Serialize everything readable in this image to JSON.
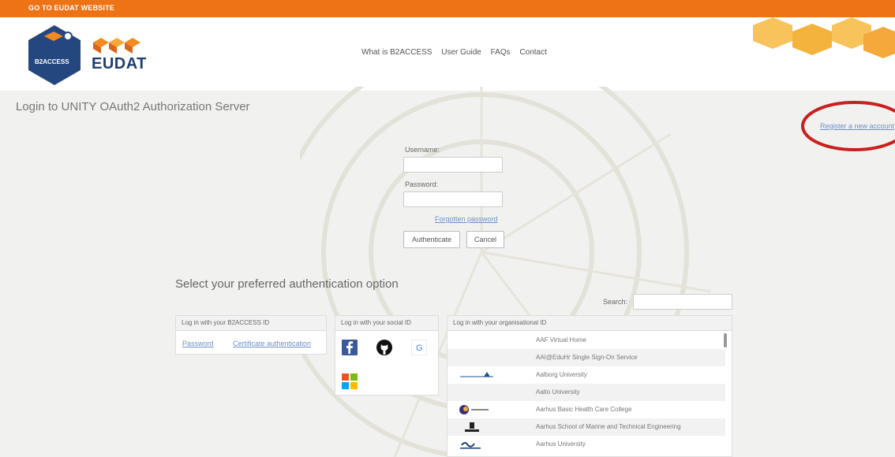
{
  "topbar": {
    "label": "GO TO EUDAT WEBSITE",
    "color": "#ee7314"
  },
  "brand": {
    "b2access_label": "B2ACCESS",
    "eudat_label": "EUDAT"
  },
  "nav": {
    "items": [
      "What is B2ACCESS",
      "User Guide",
      "FAQs",
      "Contact"
    ]
  },
  "page": {
    "title": "Login to UNITY OAuth2 Authorization Server",
    "register_link": "Register a new account"
  },
  "login": {
    "username_label": "Username:",
    "password_label": "Password:",
    "forgot_password": "Forgotten password",
    "authenticate_button": "Authenticate",
    "cancel_button": "Cancel"
  },
  "options": {
    "title": "Select your preferred authentication option",
    "search_label": "Search:",
    "b2access_panel": {
      "header": "Log in with your B2ACCESS ID",
      "password_link": "Password",
      "certificate_link": "Certificate authentication"
    },
    "social_panel": {
      "header": "Log in with your social ID",
      "providers": [
        "facebook-icon",
        "github-icon",
        "google-icon",
        "microsoft-icon"
      ]
    },
    "org_panel": {
      "header": "Log in with your organisational ID",
      "items": [
        "AAF Virtual Home",
        "AAI@EduHr Single Sign-On Service",
        "Aalborg University",
        "Aalto University",
        "Aarhus Basic Health Care College",
        "Aarhus School of Marine and Technical Engineering",
        "Aarhus University"
      ]
    }
  },
  "annotation": {
    "ellipse_color": "#c8201e"
  }
}
